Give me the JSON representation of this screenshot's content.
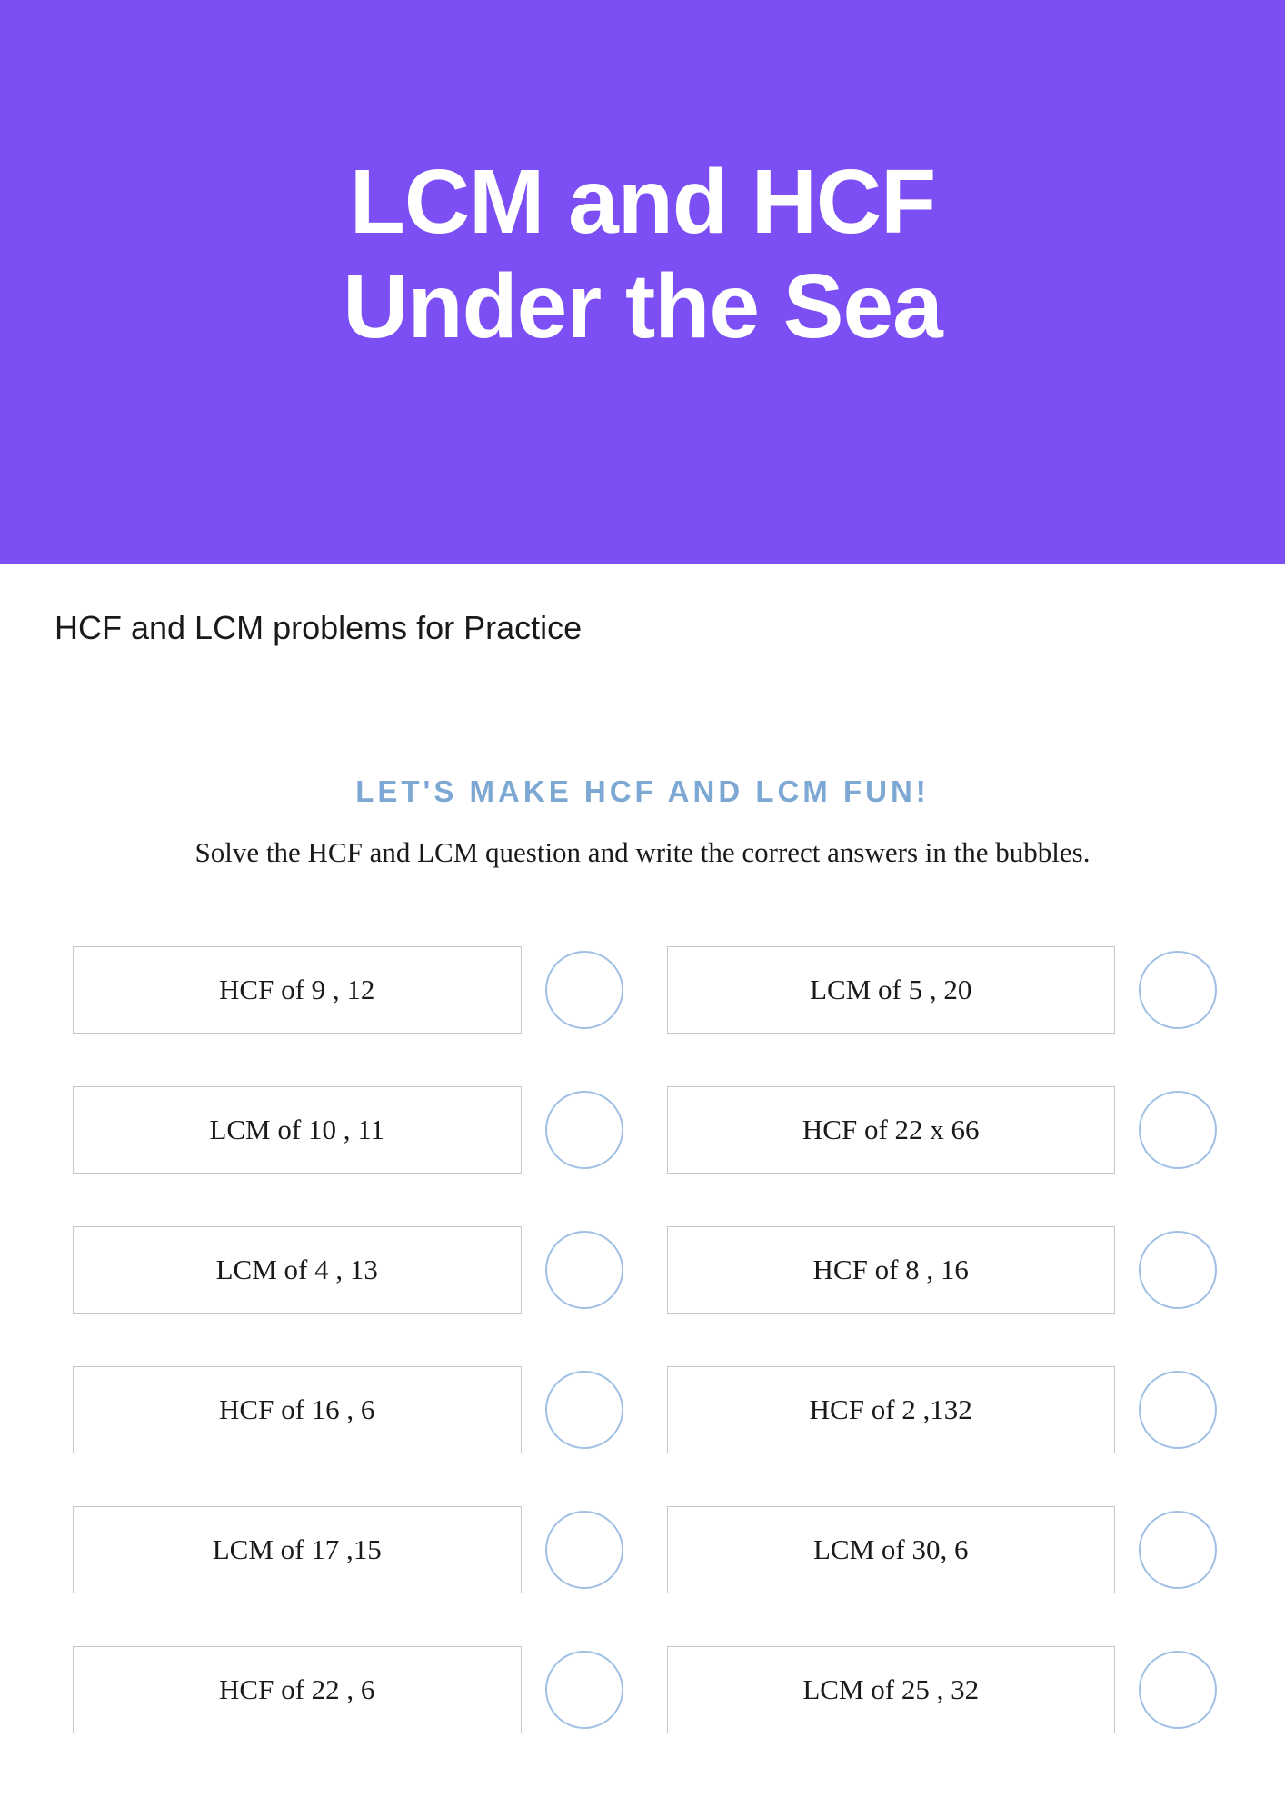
{
  "header": {
    "title_line1": "LCM and HCF",
    "title_line2": "Under the Sea"
  },
  "subtitle": "HCF and LCM problems for Practice",
  "fun_heading": "LET'S MAKE HCF AND LCM FUN!",
  "instructions": "Solve the HCF and LCM question and write the correct answers in the bubbles.",
  "problems": {
    "left": [
      "HCF of 9 , 12",
      "LCM of 10 , 11",
      "LCM of 4 , 13",
      "HCF of 16 , 6",
      "LCM of 17 ,15",
      "HCF of 22 , 6"
    ],
    "right": [
      "LCM of 5 , 20",
      "HCF of  22 x 66",
      "HCF of 8 , 16",
      "HCF of 2 ,132",
      "LCM of  30, 6",
      "LCM of 25 , 32"
    ]
  }
}
